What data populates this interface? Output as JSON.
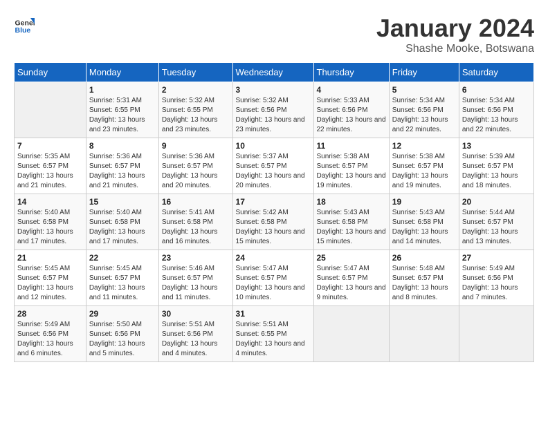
{
  "logo": {
    "line1": "General",
    "line2": "Blue"
  },
  "title": "January 2024",
  "location": "Shashe Mooke, Botswana",
  "days_of_week": [
    "Sunday",
    "Monday",
    "Tuesday",
    "Wednesday",
    "Thursday",
    "Friday",
    "Saturday"
  ],
  "weeks": [
    [
      {
        "day": "",
        "sunrise": "",
        "sunset": "",
        "daylight": ""
      },
      {
        "day": "1",
        "sunrise": "Sunrise: 5:31 AM",
        "sunset": "Sunset: 6:55 PM",
        "daylight": "Daylight: 13 hours and 23 minutes."
      },
      {
        "day": "2",
        "sunrise": "Sunrise: 5:32 AM",
        "sunset": "Sunset: 6:55 PM",
        "daylight": "Daylight: 13 hours and 23 minutes."
      },
      {
        "day": "3",
        "sunrise": "Sunrise: 5:32 AM",
        "sunset": "Sunset: 6:56 PM",
        "daylight": "Daylight: 13 hours and 23 minutes."
      },
      {
        "day": "4",
        "sunrise": "Sunrise: 5:33 AM",
        "sunset": "Sunset: 6:56 PM",
        "daylight": "Daylight: 13 hours and 22 minutes."
      },
      {
        "day": "5",
        "sunrise": "Sunrise: 5:34 AM",
        "sunset": "Sunset: 6:56 PM",
        "daylight": "Daylight: 13 hours and 22 minutes."
      },
      {
        "day": "6",
        "sunrise": "Sunrise: 5:34 AM",
        "sunset": "Sunset: 6:56 PM",
        "daylight": "Daylight: 13 hours and 22 minutes."
      }
    ],
    [
      {
        "day": "7",
        "sunrise": "Sunrise: 5:35 AM",
        "sunset": "Sunset: 6:57 PM",
        "daylight": "Daylight: 13 hours and 21 minutes."
      },
      {
        "day": "8",
        "sunrise": "Sunrise: 5:36 AM",
        "sunset": "Sunset: 6:57 PM",
        "daylight": "Daylight: 13 hours and 21 minutes."
      },
      {
        "day": "9",
        "sunrise": "Sunrise: 5:36 AM",
        "sunset": "Sunset: 6:57 PM",
        "daylight": "Daylight: 13 hours and 20 minutes."
      },
      {
        "day": "10",
        "sunrise": "Sunrise: 5:37 AM",
        "sunset": "Sunset: 6:57 PM",
        "daylight": "Daylight: 13 hours and 20 minutes."
      },
      {
        "day": "11",
        "sunrise": "Sunrise: 5:38 AM",
        "sunset": "Sunset: 6:57 PM",
        "daylight": "Daylight: 13 hours and 19 minutes."
      },
      {
        "day": "12",
        "sunrise": "Sunrise: 5:38 AM",
        "sunset": "Sunset: 6:57 PM",
        "daylight": "Daylight: 13 hours and 19 minutes."
      },
      {
        "day": "13",
        "sunrise": "Sunrise: 5:39 AM",
        "sunset": "Sunset: 6:57 PM",
        "daylight": "Daylight: 13 hours and 18 minutes."
      }
    ],
    [
      {
        "day": "14",
        "sunrise": "Sunrise: 5:40 AM",
        "sunset": "Sunset: 6:58 PM",
        "daylight": "Daylight: 13 hours and 17 minutes."
      },
      {
        "day": "15",
        "sunrise": "Sunrise: 5:40 AM",
        "sunset": "Sunset: 6:58 PM",
        "daylight": "Daylight: 13 hours and 17 minutes."
      },
      {
        "day": "16",
        "sunrise": "Sunrise: 5:41 AM",
        "sunset": "Sunset: 6:58 PM",
        "daylight": "Daylight: 13 hours and 16 minutes."
      },
      {
        "day": "17",
        "sunrise": "Sunrise: 5:42 AM",
        "sunset": "Sunset: 6:58 PM",
        "daylight": "Daylight: 13 hours and 15 minutes."
      },
      {
        "day": "18",
        "sunrise": "Sunrise: 5:43 AM",
        "sunset": "Sunset: 6:58 PM",
        "daylight": "Daylight: 13 hours and 15 minutes."
      },
      {
        "day": "19",
        "sunrise": "Sunrise: 5:43 AM",
        "sunset": "Sunset: 6:58 PM",
        "daylight": "Daylight: 13 hours and 14 minutes."
      },
      {
        "day": "20",
        "sunrise": "Sunrise: 5:44 AM",
        "sunset": "Sunset: 6:57 PM",
        "daylight": "Daylight: 13 hours and 13 minutes."
      }
    ],
    [
      {
        "day": "21",
        "sunrise": "Sunrise: 5:45 AM",
        "sunset": "Sunset: 6:57 PM",
        "daylight": "Daylight: 13 hours and 12 minutes."
      },
      {
        "day": "22",
        "sunrise": "Sunrise: 5:45 AM",
        "sunset": "Sunset: 6:57 PM",
        "daylight": "Daylight: 13 hours and 11 minutes."
      },
      {
        "day": "23",
        "sunrise": "Sunrise: 5:46 AM",
        "sunset": "Sunset: 6:57 PM",
        "daylight": "Daylight: 13 hours and 11 minutes."
      },
      {
        "day": "24",
        "sunrise": "Sunrise: 5:47 AM",
        "sunset": "Sunset: 6:57 PM",
        "daylight": "Daylight: 13 hours and 10 minutes."
      },
      {
        "day": "25",
        "sunrise": "Sunrise: 5:47 AM",
        "sunset": "Sunset: 6:57 PM",
        "daylight": "Daylight: 13 hours and 9 minutes."
      },
      {
        "day": "26",
        "sunrise": "Sunrise: 5:48 AM",
        "sunset": "Sunset: 6:57 PM",
        "daylight": "Daylight: 13 hours and 8 minutes."
      },
      {
        "day": "27",
        "sunrise": "Sunrise: 5:49 AM",
        "sunset": "Sunset: 6:56 PM",
        "daylight": "Daylight: 13 hours and 7 minutes."
      }
    ],
    [
      {
        "day": "28",
        "sunrise": "Sunrise: 5:49 AM",
        "sunset": "Sunset: 6:56 PM",
        "daylight": "Daylight: 13 hours and 6 minutes."
      },
      {
        "day": "29",
        "sunrise": "Sunrise: 5:50 AM",
        "sunset": "Sunset: 6:56 PM",
        "daylight": "Daylight: 13 hours and 5 minutes."
      },
      {
        "day": "30",
        "sunrise": "Sunrise: 5:51 AM",
        "sunset": "Sunset: 6:56 PM",
        "daylight": "Daylight: 13 hours and 4 minutes."
      },
      {
        "day": "31",
        "sunrise": "Sunrise: 5:51 AM",
        "sunset": "Sunset: 6:55 PM",
        "daylight": "Daylight: 13 hours and 4 minutes."
      },
      {
        "day": "",
        "sunrise": "",
        "sunset": "",
        "daylight": ""
      },
      {
        "day": "",
        "sunrise": "",
        "sunset": "",
        "daylight": ""
      },
      {
        "day": "",
        "sunrise": "",
        "sunset": "",
        "daylight": ""
      }
    ]
  ]
}
